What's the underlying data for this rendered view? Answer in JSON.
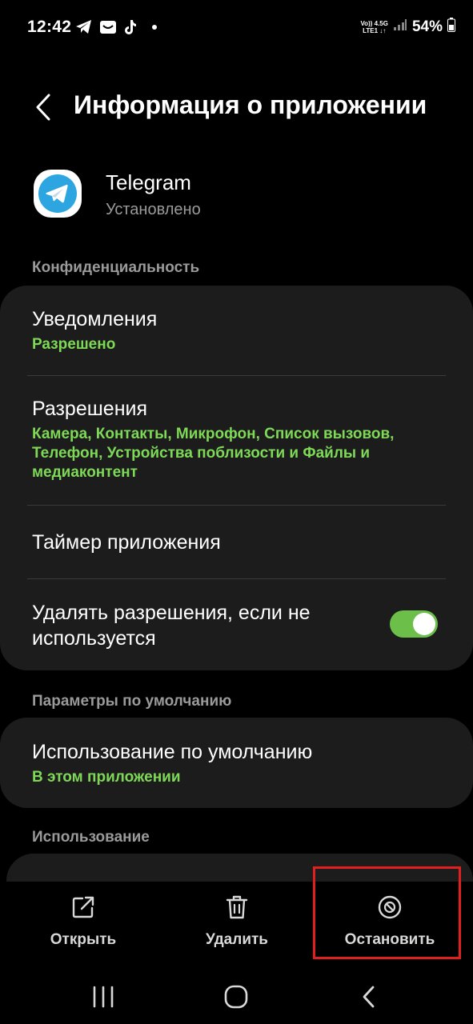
{
  "status_bar": {
    "time": "12:42",
    "network_top": "Vo)) 4.5G",
    "network_bottom": "LTE1 ↓↑",
    "battery": "54%"
  },
  "header": {
    "title": "Информация о приложении"
  },
  "app": {
    "name": "Telegram",
    "status": "Установлено"
  },
  "sections": {
    "privacy": "Конфиденциальность",
    "defaults": "Параметры по умолчанию",
    "usage": "Использование"
  },
  "privacy_card": {
    "notifications_title": "Уведомления",
    "notifications_sub": "Разрешено",
    "permissions_title": "Разрешения",
    "permissions_sub": "Камера, Контакты, Микрофон, Список вызовов, Телефон, Устройства поблизости и Файлы и медиаконтент",
    "timer_title": "Таймер приложения",
    "remove_perms_title": "Удалять разрешения, если не используется",
    "remove_perms_enabled": true
  },
  "defaults_card": {
    "title": "Использование по умолчанию",
    "sub": "В этом приложении"
  },
  "bottom_actions": {
    "open": "Открыть",
    "delete": "Удалить",
    "stop": "Остановить"
  },
  "colors": {
    "accent_green": "#7ed957",
    "toggle_on": "#6cc04a",
    "highlight": "#e02020",
    "card_bg": "#1c1c1c"
  }
}
